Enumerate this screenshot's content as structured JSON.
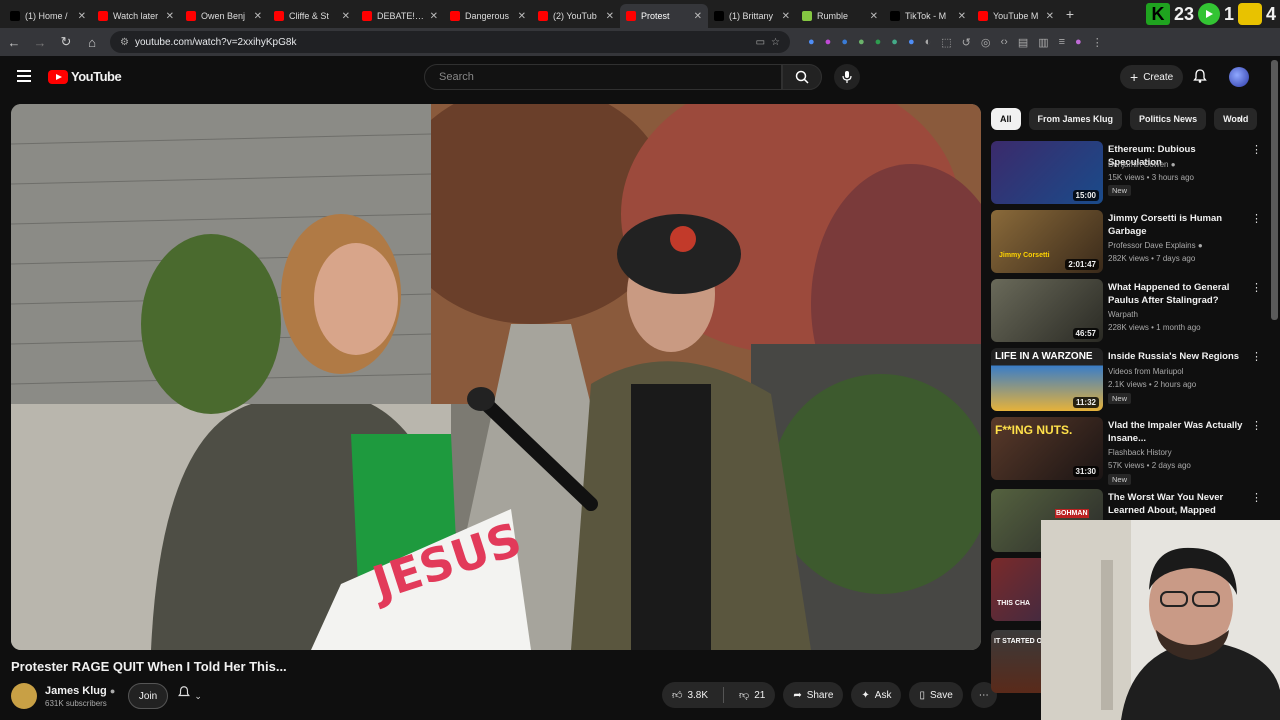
{
  "browser": {
    "tabs": [
      {
        "title": "(1) Home /",
        "color": "#000000",
        "active": false
      },
      {
        "title": "Watch later",
        "color": "#ff0000",
        "active": false
      },
      {
        "title": "Owen Benj",
        "color": "#ff0000",
        "active": false
      },
      {
        "title": "Cliffe & St",
        "color": "#ff0000",
        "active": false
      },
      {
        "title": "DEBATE! W",
        "color": "#ff0000",
        "active": false
      },
      {
        "title": "Dangerous",
        "color": "#ff0000",
        "active": false
      },
      {
        "title": "(2) YouTub",
        "color": "#ff0000",
        "active": false
      },
      {
        "title": "Protest",
        "color": "#ff0000",
        "active": true
      },
      {
        "title": "(1) Brittany",
        "color": "#000000",
        "active": false
      },
      {
        "title": "Rumble",
        "color": "#85c742",
        "active": false
      },
      {
        "title": "TikTok - M",
        "color": "#000000",
        "active": false
      },
      {
        "title": "YouTube M",
        "color": "#ff0000",
        "active": false
      }
    ],
    "corner_overlay": {
      "a": "23",
      "b": "1",
      "c": "4"
    },
    "url": "youtube.com/watch?v=2xxihyKpG8k"
  },
  "header": {
    "logo_text": "YouTube",
    "search_placeholder": "Search",
    "create_label": "Create"
  },
  "video": {
    "title": "Protester RAGE QUIT When I Told Her This...",
    "sign_text": "JESUS"
  },
  "channel": {
    "name": "James Klug",
    "subscribers": "631K subscribers",
    "join_label": "Join"
  },
  "actions": {
    "likes": "3.8K",
    "dislikes": "21",
    "share": "Share",
    "ask": "Ask",
    "save": "Save"
  },
  "chips": [
    "All",
    "From James Klug",
    "Politics News",
    "World"
  ],
  "recommendations": [
    {
      "title": "Ethereum: Dubious Speculation",
      "channel": "Benjamin Cowen",
      "verified": true,
      "meta": "15K views • 3 hours ago",
      "badge": "New",
      "duration": "15:00",
      "thumb": "#2a3a6a"
    },
    {
      "title": "Jimmy Corsetti is Human Garbage",
      "channel": "Professor Dave Explains",
      "verified": true,
      "meta": "282K views • 7 days ago",
      "badge": "",
      "duration": "2:01:47",
      "thumb": "#7a5c3a"
    },
    {
      "title": "What Happened to General Paulus After Stalingrad?",
      "channel": "Warpath",
      "verified": false,
      "meta": "228K views • 1 month ago",
      "badge": "",
      "duration": "46:57",
      "thumb": "#5a5a50"
    },
    {
      "title": "Inside Russia's New Regions",
      "channel": "Videos from Mariupol",
      "verified": false,
      "meta": "2.1K views • 2 hours ago",
      "badge": "New",
      "duration": "11:32",
      "thumb": "#2c6bb0"
    },
    {
      "title": "Vlad the Impaler Was Actually Insane...",
      "channel": "Flashback History",
      "verified": false,
      "meta": "57K views • 2 days ago",
      "badge": "New",
      "duration": "31:30",
      "thumb": "#3a2a2a"
    },
    {
      "title": "The Worst War You Never Learned About, Mapped",
      "channel": "",
      "verified": false,
      "meta": "",
      "badge": "",
      "duration": "",
      "thumb": "#4b5a3a"
    }
  ],
  "thumb_overlays": {
    "r1": "Jimmy Corsetti",
    "r3": "LIFE IN A WARZONE",
    "r4": "F**ING NUTS.",
    "r5": "BOHMAN",
    "r6": "THIS CHA",
    "r7": "IT STARTED ON"
  }
}
